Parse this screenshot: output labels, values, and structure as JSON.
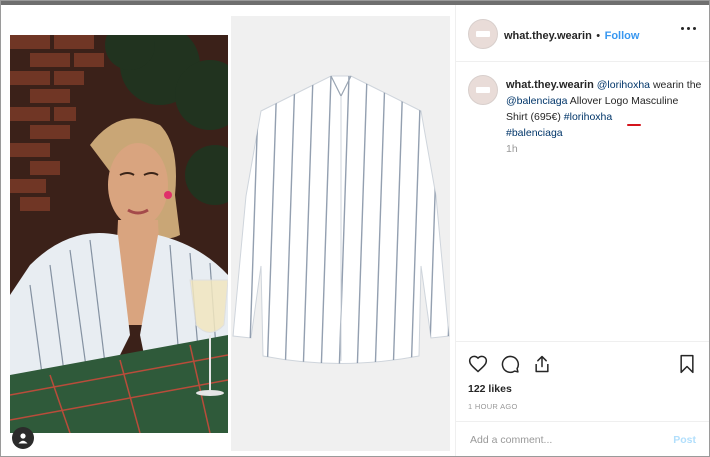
{
  "post": {
    "username": "what.they.wearin",
    "separator": "•",
    "follow_label": "Follow",
    "more_icon": "more-options-icon"
  },
  "caption": {
    "author": "what.they.wearin",
    "mention_person": "@lorihoxha",
    "text1": " wearin the ",
    "mention_brand": "@balenciaga",
    "text2": " Allover Logo ",
    "highlighted_item": "Masculine Shirt (695€)",
    "space": " ",
    "tag1": "#lorihoxha",
    "tag2": "#balenciaga",
    "age": "1h"
  },
  "actions": {
    "icons": [
      "heart-icon",
      "comment-icon",
      "share-icon",
      "bookmark-icon"
    ],
    "likes": "122 likes",
    "timestamp": "1 HOUR AGO"
  },
  "comment": {
    "placeholder": "Add a comment...",
    "post_label": "Post"
  },
  "colors": {
    "accent_blue": "#3897f0",
    "link_dark": "#003569",
    "underline_red": "#d4141c",
    "post_disabled": "#b2dffc"
  }
}
